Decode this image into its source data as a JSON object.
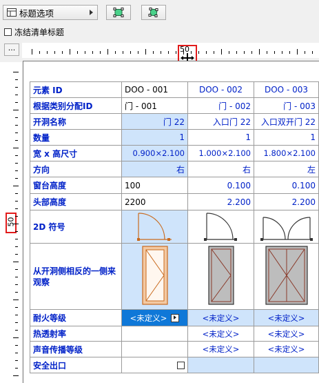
{
  "toolbar": {
    "dropdown_label": "标题选项",
    "freeze_label": "冻结清单标题",
    "more_label": "..."
  },
  "rulers": {
    "h_label": "50",
    "v_label": "50"
  },
  "schedule": {
    "headers": {
      "element_id": "元素 ID",
      "by_category_id": "根据类别分配ID",
      "opening_name": "开洞名称",
      "quantity": "数量",
      "size": "宽 x 高尺寸",
      "direction": "方向",
      "sill": "窗台高度",
      "head": "头部高度",
      "symbol_2d": "2D 符号",
      "view_opposite": "从开洞侧相反的一侧来观察",
      "fire": "耐火等级",
      "thermal": "热透射率",
      "acoustic": "声音传播等级",
      "exit": "安全出口"
    },
    "columns": [
      {
        "element_id": "DOO - 001",
        "by_category_id": "门 - 001",
        "opening_name": "门 22",
        "quantity": "1",
        "size": "0.900×2.100",
        "direction": "右",
        "sill": "100",
        "head": "2200",
        "fire": "<未定义>",
        "thermal": "",
        "acoustic": ""
      },
      {
        "element_id": "DOO - 002",
        "by_category_id": "门 - 002",
        "opening_name": "入口门 22",
        "quantity": "1",
        "size": "1.000×2.100",
        "direction": "右",
        "sill": "0.100",
        "head": "2.200",
        "fire": "<未定义>",
        "thermal": "<未定义>",
        "acoustic": "<未定义>"
      },
      {
        "element_id": "DOO - 003",
        "by_category_id": "门 - 003",
        "opening_name": "入口双开门 22",
        "quantity": "1",
        "size": "1.800×2.100",
        "direction": "左",
        "sill": "0.100",
        "head": "2.200",
        "fire": "<未定义>",
        "thermal": "<未定义>",
        "acoustic": "<未定义>"
      }
    ]
  },
  "colors": {
    "label_blue": "#0021c8",
    "selection": "#cfe4fb",
    "highlight_red": "#e21b1b",
    "door_orange": "#c96a1e"
  }
}
